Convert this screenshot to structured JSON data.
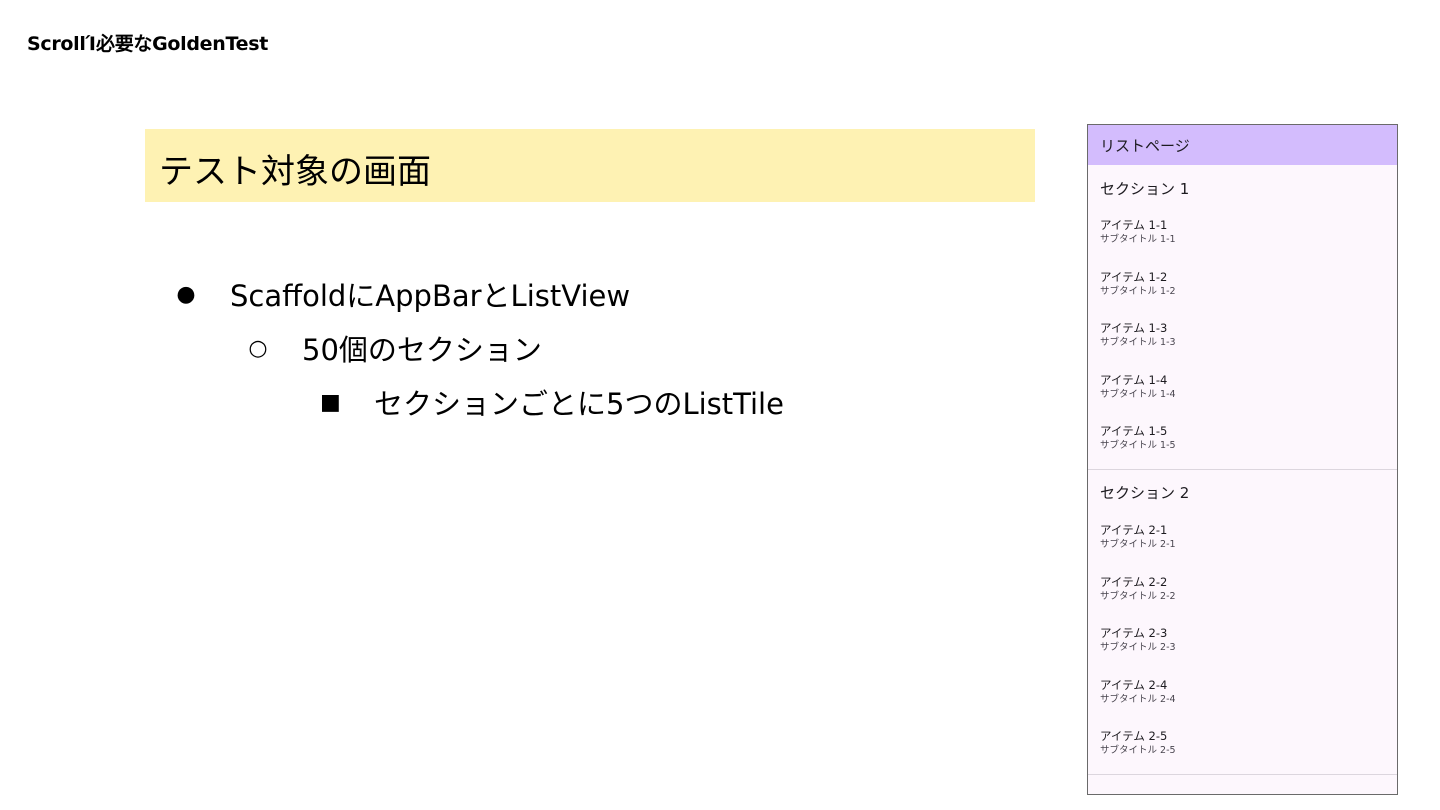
{
  "slide": {
    "header": "ScrollΊ必要なGoldenTest",
    "title": "テスト対象の画面",
    "bullets": [
      {
        "marker": "●",
        "text": "ScaffoldにAppBarとListView"
      },
      {
        "marker": "○",
        "text": "50個のセクション"
      },
      {
        "marker": "■",
        "text": "セクションごとに5つのListTile"
      }
    ]
  },
  "phone": {
    "appbar_title": "リストページ",
    "sections": [
      {
        "header": "セクション 1",
        "items": [
          {
            "title": "アイテム 1-1",
            "subtitle": "サブタイトル 1-1"
          },
          {
            "title": "アイテム 1-2",
            "subtitle": "サブタイトル 1-2"
          },
          {
            "title": "アイテム 1-3",
            "subtitle": "サブタイトル 1-3"
          },
          {
            "title": "アイテム 1-4",
            "subtitle": "サブタイトル 1-4"
          },
          {
            "title": "アイテム 1-5",
            "subtitle": "サブタイトル 1-5"
          }
        ]
      },
      {
        "header": "セクション 2",
        "items": [
          {
            "title": "アイテム 2-1",
            "subtitle": "サブタイトル 2-1"
          },
          {
            "title": "アイテム 2-2",
            "subtitle": "サブタイトル 2-2"
          },
          {
            "title": "アイテム 2-3",
            "subtitle": "サブタイトル 2-3"
          },
          {
            "title": "アイテム 2-4",
            "subtitle": "サブタイトル 2-4"
          },
          {
            "title": "アイテム 2-5",
            "subtitle": "サブタイトル 2-5"
          }
        ]
      }
    ]
  },
  "colors": {
    "title_highlight": "#fef2b3",
    "appbar": "#d3bcfd",
    "phone_background": "#fdf7fd"
  }
}
